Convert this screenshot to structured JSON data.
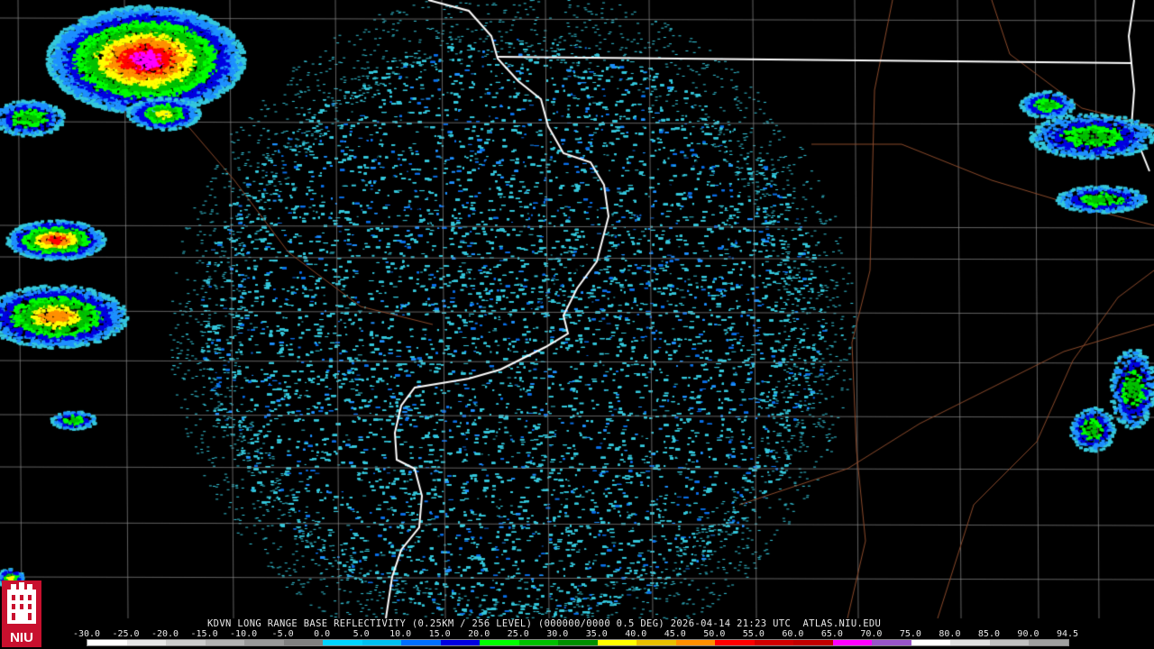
{
  "header": {
    "caption": "KDVN LONG RANGE BASE REFLECTIVITY (0.25KM / 256 LEVEL) (000000/0000 0.5 DEG) 2026-04-14 21:23 UTC  ATLAS.NIU.EDU"
  },
  "scale": {
    "labels": [
      "-30.0",
      "-25.0",
      "-20.0",
      "-15.0",
      "-10.0",
      "-5.0",
      "0.0",
      "5.0",
      "10.0",
      "15.0",
      "20.0",
      "25.0",
      "30.0",
      "35.0",
      "40.0",
      "45.0",
      "50.0",
      "55.0",
      "60.0",
      "65.0",
      "70.0",
      "75.0",
      "80.0",
      "85.0",
      "90.0",
      "94.5"
    ],
    "colors": [
      "#ffffff",
      "#e6e6e6",
      "#cccccc",
      "#b3b3b3",
      "#999999",
      "#808080",
      "#00d4ff",
      "#00c0f0",
      "#0070ff",
      "#0000e0",
      "#00ff00",
      "#00c000",
      "#009000",
      "#ffff00",
      "#e8c000",
      "#ff9000",
      "#ff0000",
      "#d00000",
      "#c00000",
      "#ff00ff",
      "#9955c9",
      "#ffffff",
      "#e0e0e0",
      "#c0c0c0",
      "#a0a0a0"
    ]
  },
  "logo": {
    "text": "NIU",
    "colors": {
      "red": "#c8102e",
      "white": "#ffffff"
    }
  },
  "colors": {
    "background": "#000000",
    "county_lines": "#8c8c8c",
    "state_lines": "#ffffff",
    "roads": "#8b4a2b",
    "clutter": "#35c8dc"
  }
}
